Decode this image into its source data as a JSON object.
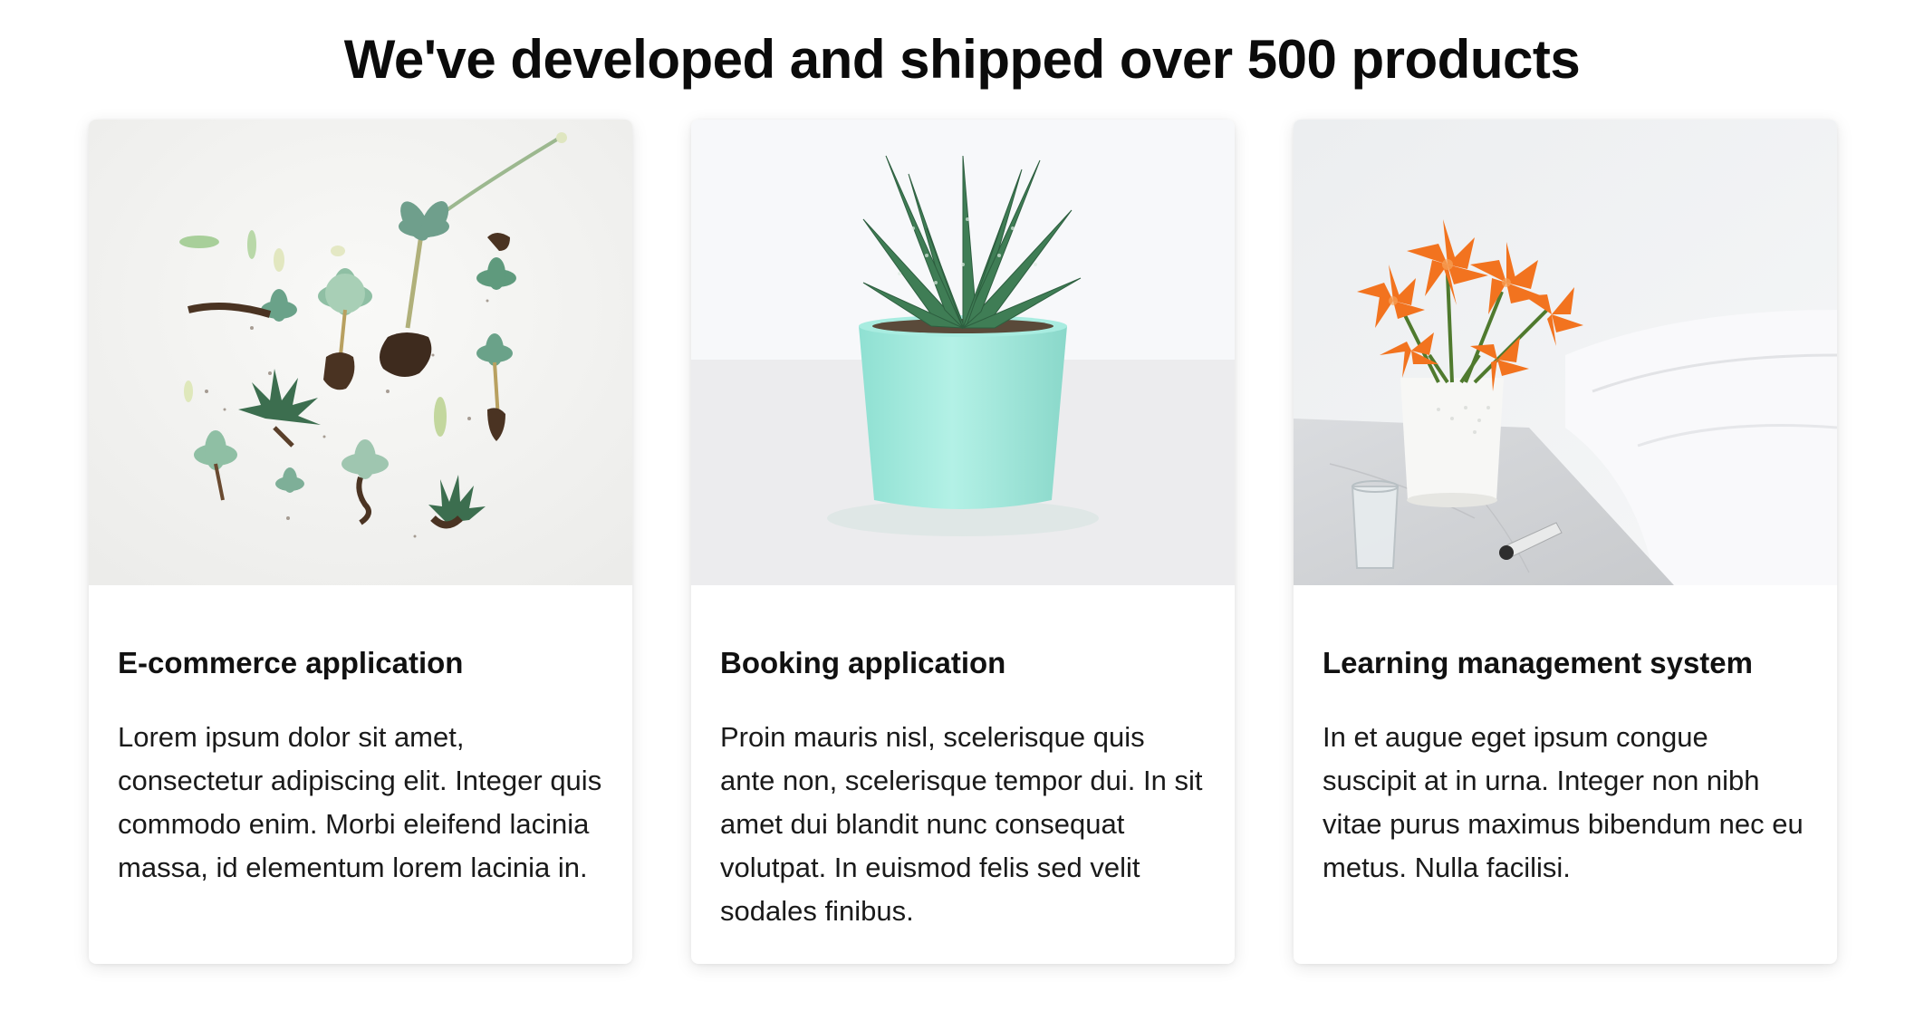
{
  "headline": "We've developed and shipped over 500 products",
  "cards": [
    {
      "title": "E-commerce application",
      "text": "Lorem ipsum dolor sit amet, consectetur adipiscing elit. Integer quis commodo enim. Morbi eleifend lacinia massa, id elementum lorem lacinia in.",
      "image": "succulent-cuttings-photo"
    },
    {
      "title": "Booking application",
      "text": "Proin mauris nisl, scelerisque quis ante non, scelerisque tempor dui. In sit amet dui blandit nunc consequat volutpat. In euismod felis sed velit sodales finibus.",
      "image": "potted-succulent-photo"
    },
    {
      "title": "Learning management system",
      "text": "In et augue eget ipsum congue suscipit at in urna. Integer non nibh vitae purus maximus bibendum nec eu metus. Nulla facilisi.",
      "image": "orange-lilies-vase-photo"
    }
  ],
  "colors": {
    "text": "#111111",
    "pot": "#a8ece0",
    "flower": "#f2731f",
    "succulent": "#5f8f6a"
  }
}
